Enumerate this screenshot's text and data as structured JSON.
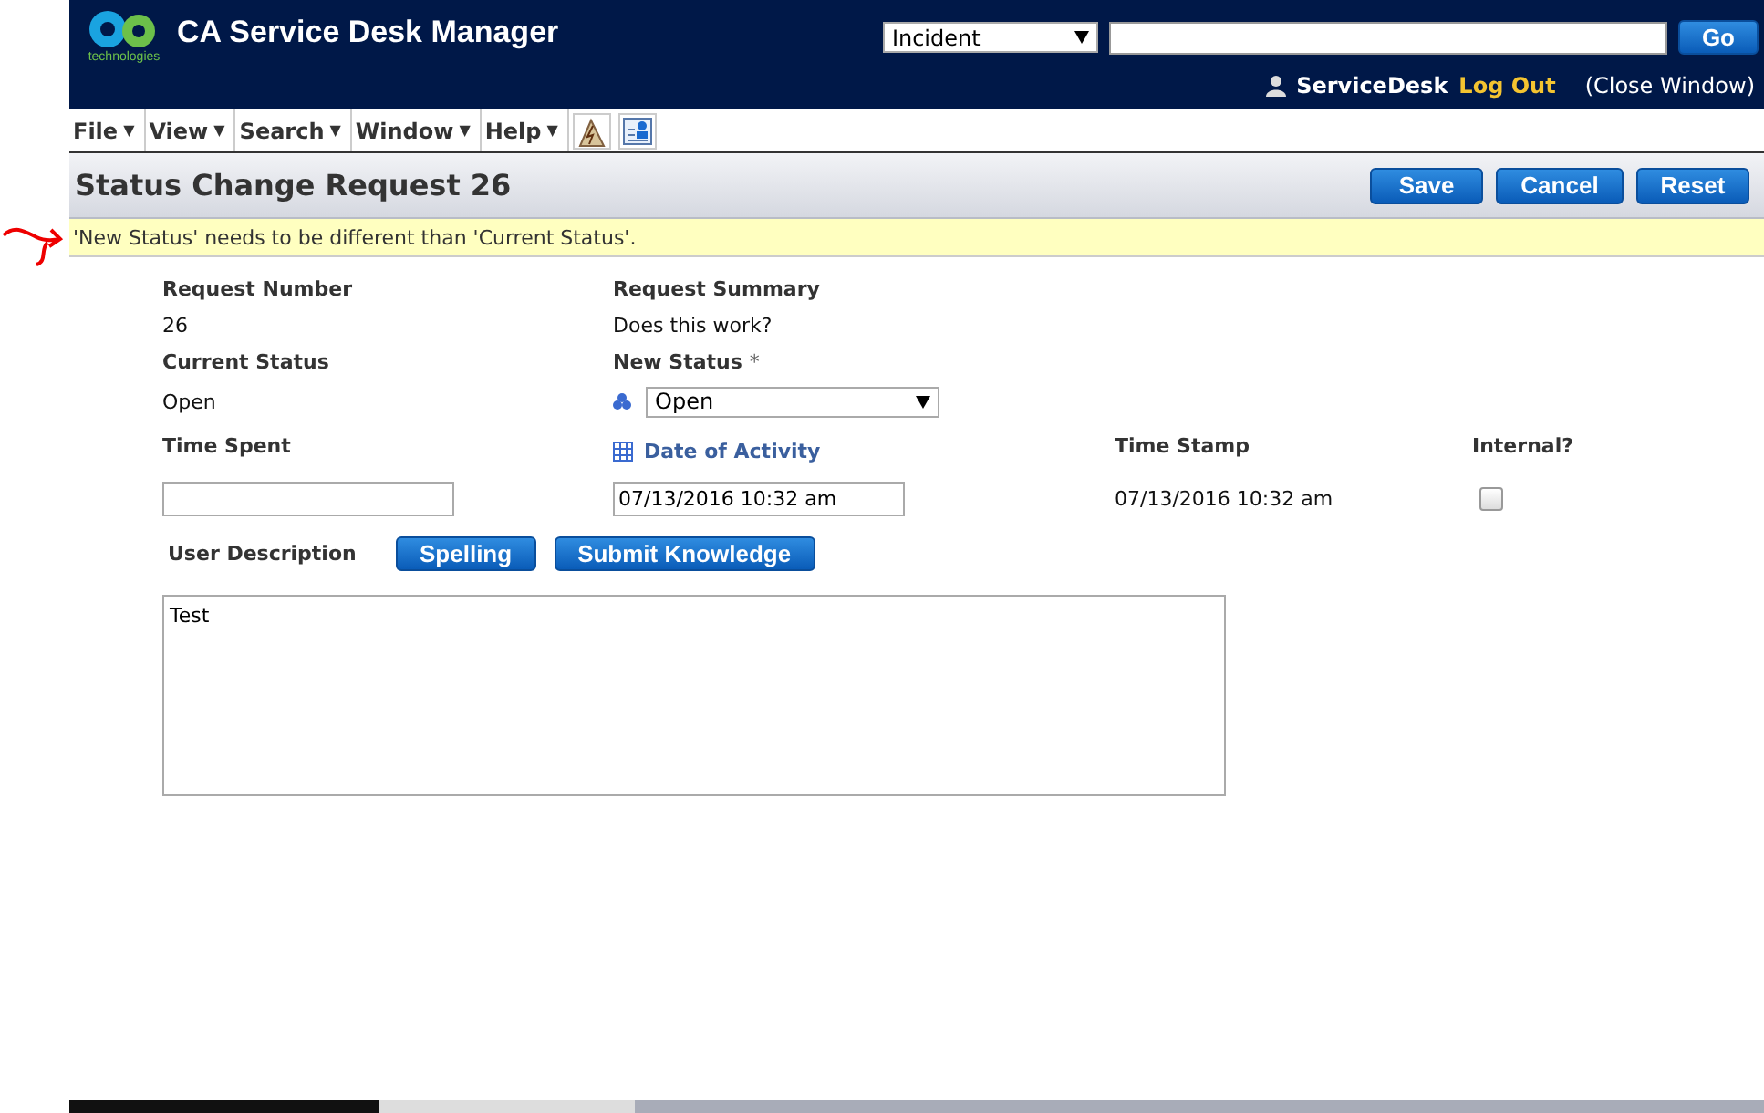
{
  "header": {
    "logo_caption": "technologies",
    "app_title": "CA Service Desk Manager",
    "search_type": "Incident",
    "go_button": "Go",
    "user": "ServiceDesk",
    "logout": "Log Out",
    "close_window": "(Close Window)"
  },
  "menu": [
    {
      "label": "File",
      "arrow": "▼"
    },
    {
      "label": "View",
      "arrow": "▼"
    },
    {
      "label": "Search",
      "arrow": "▼"
    },
    {
      "label": "Window",
      "arrow": "▼"
    },
    {
      "label": "Help",
      "arrow": "▼"
    }
  ],
  "page_title": "Status Change Request 26",
  "actions": [
    "Save",
    "Cancel",
    "Reset"
  ],
  "message": "'New Status' needs to be different than 'Current Status'.",
  "form": {
    "request_number": {
      "label": "Request Number",
      "value": "26"
    },
    "request_summary": {
      "label": "Request Summary",
      "value": "Does this work?"
    },
    "current_status": {
      "label": "Current Status",
      "value": "Open"
    },
    "new_status": {
      "label": "New Status",
      "required_mark": "*",
      "value": "Open"
    },
    "time_spent": {
      "label": "Time Spent"
    },
    "date_of_activity": {
      "label": "Date of Activity",
      "value": "07/13/2016 10:32 am"
    },
    "time_stamp": {
      "label": "Time Stamp",
      "value": "07/13/2016 10:32 am"
    },
    "internal": {
      "label": "Internal?",
      "checked": false
    },
    "user_description": {
      "label": "User Description",
      "buttons": [
        "Spelling",
        "Submit Knowledge"
      ],
      "value": "Test"
    }
  }
}
